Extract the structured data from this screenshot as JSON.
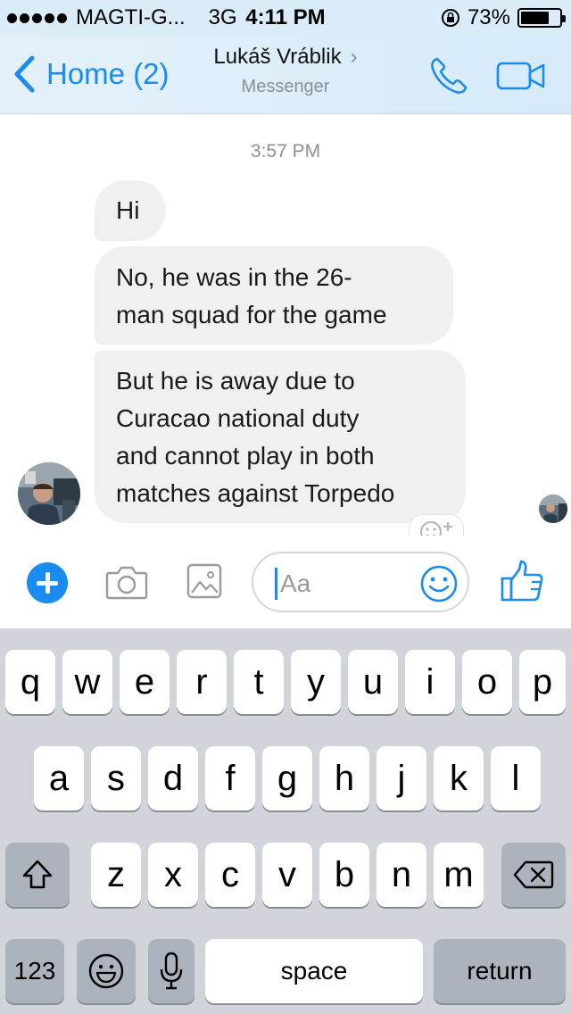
{
  "status_bar": {
    "carrier": "MAGTI-G...",
    "network": "3G",
    "time": "4:11 PM",
    "battery": "73%",
    "battery_level": 0.73
  },
  "nav": {
    "back_label": "Home (2)",
    "contact_name": "Lukáš Vráblik",
    "chevron": "›",
    "subtitle": "Messenger",
    "call_icon": "phone-icon",
    "video_icon": "video-camera-icon"
  },
  "conversation": {
    "timestamp": "3:57 PM",
    "messages": [
      {
        "lines": [
          "Hi"
        ]
      },
      {
        "lines": [
          "No, he was in the 26-",
          "man squad for the game"
        ]
      },
      {
        "lines": [
          "But he is away due to",
          "Curacao national duty",
          "and cannot play in both",
          "matches against Torpedo"
        ]
      }
    ]
  },
  "composer": {
    "placeholder": "Aa",
    "icons": [
      "plus-icon",
      "camera-icon",
      "photo-icon",
      "emoji-icon",
      "like-icon"
    ],
    "accent": "#1a8cf0"
  },
  "keyboard": {
    "row1": [
      "q",
      "w",
      "e",
      "r",
      "t",
      "y",
      "u",
      "i",
      "o",
      "p"
    ],
    "row2": [
      "a",
      "s",
      "d",
      "f",
      "g",
      "h",
      "j",
      "k",
      "l"
    ],
    "row3": [
      "z",
      "x",
      "c",
      "v",
      "b",
      "n",
      "m"
    ],
    "numbers_label": "123",
    "space_label": "space",
    "return_label": "return"
  }
}
